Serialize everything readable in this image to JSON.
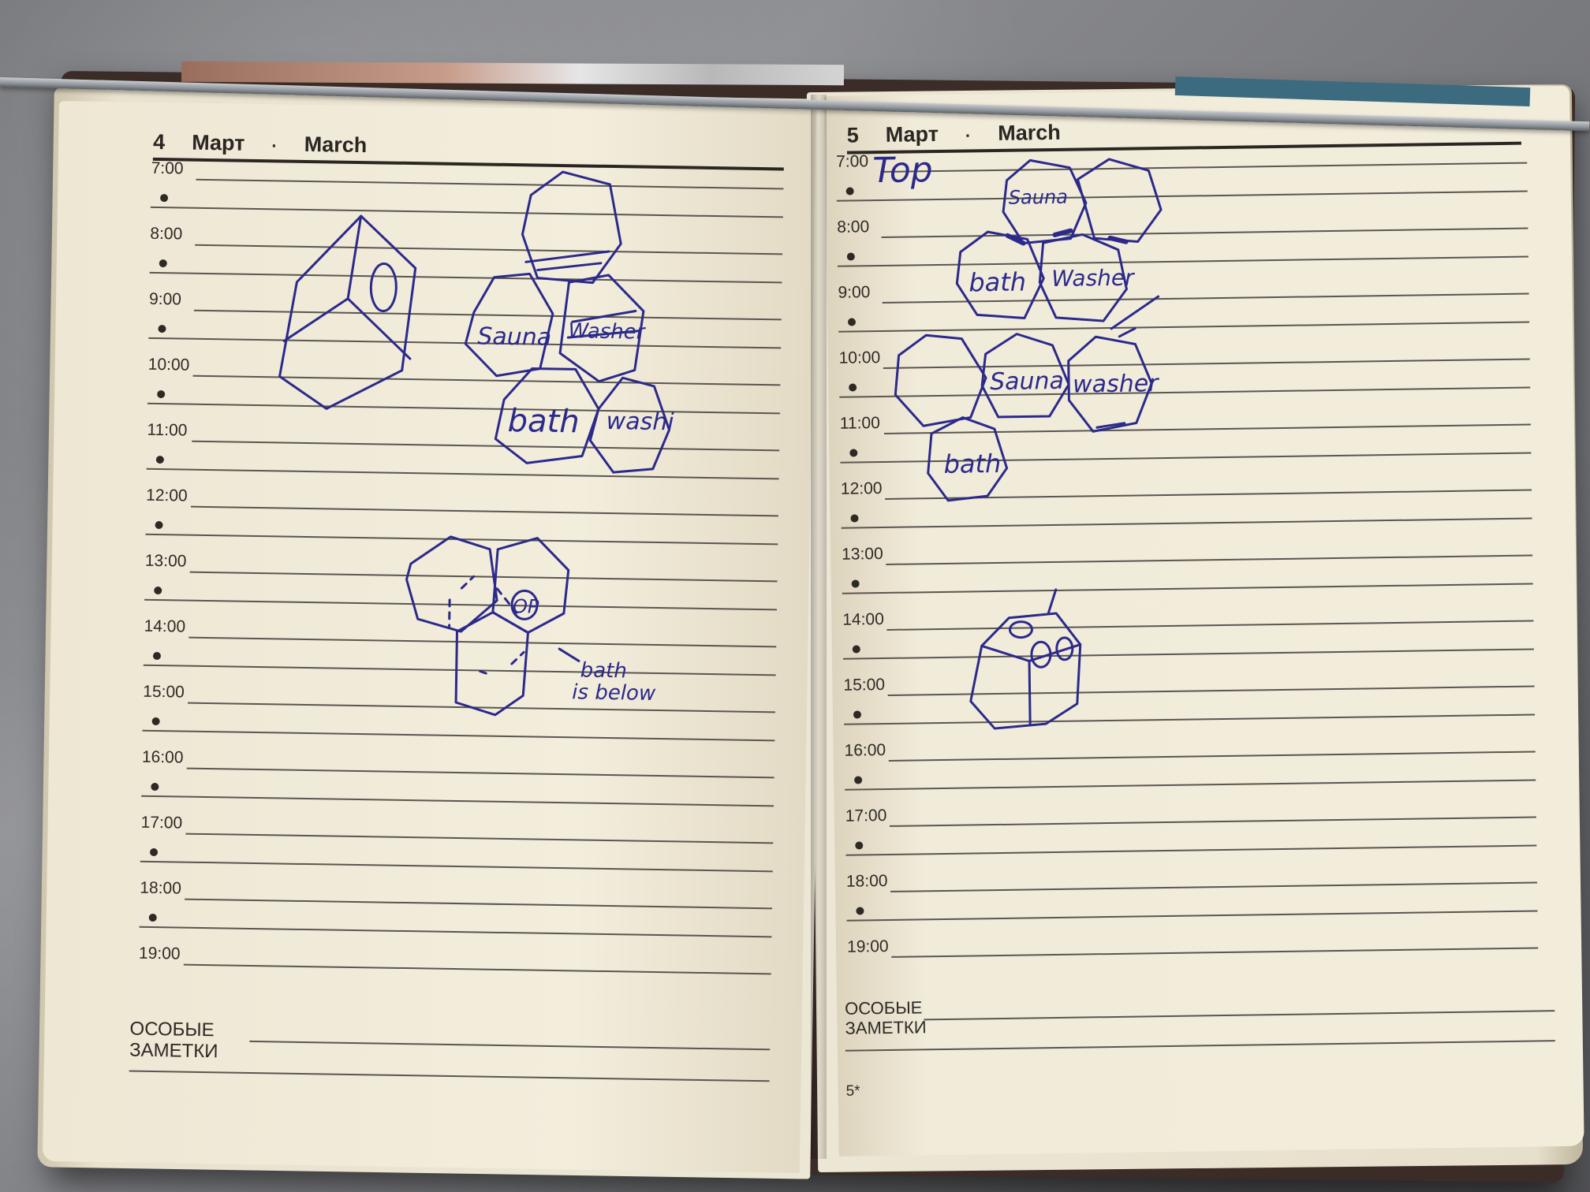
{
  "left_page": {
    "day": "4",
    "month_ru": "Март",
    "month_en": "March",
    "separator": "·",
    "hours": [
      "7:00",
      "8:00",
      "9:00",
      "10:00",
      "11:00",
      "12:00",
      "13:00",
      "14:00",
      "15:00",
      "16:00",
      "17:00",
      "18:00",
      "19:00"
    ],
    "notes_label_1": "ОСОБЫЕ",
    "notes_label_2": "ЗАМЕТКИ",
    "sketch_text": {
      "sauna": "Sauna",
      "washer": "Washer",
      "bath": "bath",
      "washi": "washi",
      "op": "OP",
      "note_line1": "bath",
      "note_line2": "is below"
    }
  },
  "right_page": {
    "day": "5",
    "month_ru": "Март",
    "month_en": "March",
    "separator": "·",
    "hours": [
      "7:00",
      "8:00",
      "9:00",
      "10:00",
      "11:00",
      "12:00",
      "13:00",
      "14:00",
      "15:00",
      "16:00",
      "17:00",
      "18:00",
      "19:00"
    ],
    "notes_label_1": "ОСОБЫЕ",
    "notes_label_2": "ЗАМЕТКИ",
    "page_number": "5*",
    "sketch_text": {
      "top": "Top",
      "sauna": "Sauna",
      "bath": "bath",
      "washer": "Washer",
      "sauna2": "Sauna",
      "washer2": "washer",
      "bath2": "bath"
    }
  },
  "colors": {
    "ink": "#2b2a8c",
    "paper": "#f0ead9",
    "print": "#2a2622"
  }
}
